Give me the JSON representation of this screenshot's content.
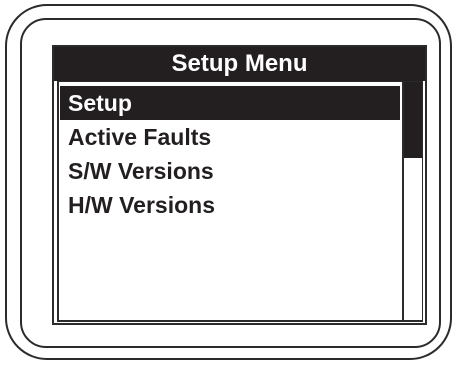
{
  "title": "Setup Menu",
  "menu": {
    "items": [
      {
        "label": "Setup",
        "selected": true
      },
      {
        "label": "Active Faults",
        "selected": false
      },
      {
        "label": "S/W Versions",
        "selected": false
      },
      {
        "label": "H/W Versions",
        "selected": false
      }
    ]
  },
  "colors": {
    "bezel": "#2b2b2b",
    "title_bg": "#231f20",
    "selected_bg": "#231f20",
    "text": "#231f20",
    "background": "#ffffff"
  }
}
